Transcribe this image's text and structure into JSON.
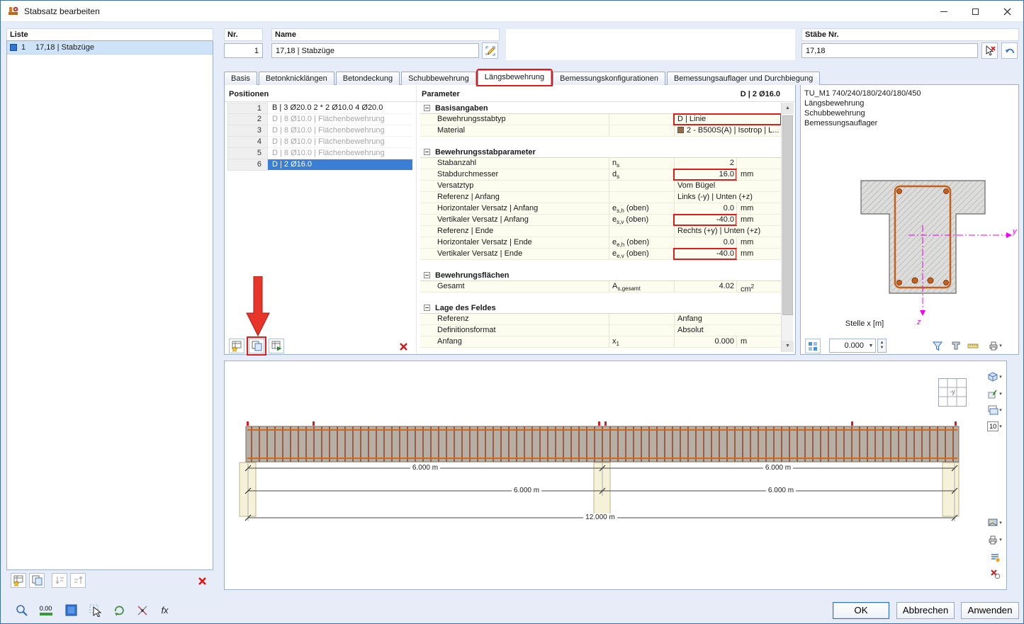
{
  "window": {
    "title": "Stabsatz bearbeiten"
  },
  "liste": {
    "label": "Liste",
    "items": [
      {
        "nr": "1",
        "label": "17,18 | Stabzüge"
      }
    ]
  },
  "header": {
    "nr": {
      "label": "Nr.",
      "value": "1"
    },
    "name": {
      "label": "Name",
      "value": "17,18 | Stabzüge"
    },
    "staebe": {
      "label": "Stäbe Nr.",
      "value": "17,18"
    }
  },
  "tabs": [
    "Basis",
    "Betonknicklängen",
    "Betondeckung",
    "Schubbewehrung",
    "Längsbewehrung",
    "Bemessungskonfigurationen",
    "Bemessungsauflager und Durchbiegung"
  ],
  "active_tab": "Längsbewehrung",
  "positionen": {
    "title": "Positionen",
    "rows": [
      {
        "nr": "1",
        "text": "B | 3 Ø20.0 2 * 2 Ø10.0 4 Ø20.0",
        "state": "normal"
      },
      {
        "nr": "2",
        "text": "D | 8 Ø10.0 | Flächenbewehrung",
        "state": "dim"
      },
      {
        "nr": "3",
        "text": "D | 8 Ø10.0 | Flächenbewehrung",
        "state": "dim"
      },
      {
        "nr": "4",
        "text": "D | 8 Ø10.0 | Flächenbewehrung",
        "state": "dim"
      },
      {
        "nr": "5",
        "text": "D | 8 Ø10.0 | Flächenbewehrung",
        "state": "dim"
      },
      {
        "nr": "6",
        "text": "D | 2 Ø16.0",
        "state": "selected"
      }
    ]
  },
  "parameter": {
    "title": "Parameter",
    "selection": "D | 2 Ø16.0",
    "sections": [
      {
        "title": "Basisangaben",
        "rows": [
          {
            "label": "Bewehrungsstabtyp",
            "symbol": "",
            "value": "D | Linie",
            "unit": "",
            "value_align": "left",
            "highlight": true
          },
          {
            "label": "Material",
            "symbol": "",
            "value": "2 - B500S(A) | Isotrop | L...",
            "unit": "",
            "value_align": "left",
            "swatch": "#9b6a49"
          }
        ]
      },
      {
        "title": "Bewehrungsstabparameter",
        "rows": [
          {
            "label": "Stabanzahl",
            "symbol": "n_{s}",
            "value": "2",
            "unit": ""
          },
          {
            "label": "Stabdurchmesser",
            "symbol": "d_{s}",
            "value": "16.0",
            "unit": "mm",
            "highlight": true
          },
          {
            "label": "Versatztyp",
            "symbol": "",
            "value": "Vom Bügel",
            "unit": "",
            "value_align": "left"
          },
          {
            "label": "Referenz | Anfang",
            "symbol": "",
            "value": "Links (-y) | Unten (+z)",
            "unit": "",
            "value_align": "left"
          },
          {
            "label": "Horizontaler Versatz | Anfang",
            "symbol": "e_{s,h} (oben)",
            "value": "0.0",
            "unit": "mm"
          },
          {
            "label": "Vertikaler Versatz | Anfang",
            "symbol": "e_{s,v} (oben)",
            "value": "-40.0",
            "unit": "mm",
            "highlight": true
          },
          {
            "label": "Referenz | Ende",
            "symbol": "",
            "value": "Rechts (+y) | Unten (+z)",
            "unit": "",
            "value_align": "left"
          },
          {
            "label": "Horizontaler Versatz | Ende",
            "symbol": "e_{e,h} (oben)",
            "value": "0.0",
            "unit": "mm"
          },
          {
            "label": "Vertikaler Versatz | Ende",
            "symbol": "e_{e,v} (oben)",
            "value": "-40.0",
            "unit": "mm",
            "highlight": true
          }
        ]
      },
      {
        "title": "Bewehrungsflächen",
        "rows": [
          {
            "label": "Gesamt",
            "symbol": "A_{s,gesamt}",
            "value": "4.02",
            "unit": "cm^{2}"
          }
        ]
      },
      {
        "title": "Lage des Feldes",
        "rows": [
          {
            "label": "Referenz",
            "symbol": "",
            "value": "Anfang",
            "unit": "",
            "value_align": "left"
          },
          {
            "label": "Definitionsformat",
            "symbol": "",
            "value": "Absolut",
            "unit": "",
            "value_align": "left"
          },
          {
            "label": "Anfang",
            "symbol": "x_{1}",
            "value": "0.000",
            "unit": "m"
          }
        ]
      }
    ]
  },
  "section_panel": {
    "info_lines": [
      "TU_M1 740/240/180/240/180/450",
      "Längsbewehrung",
      "Schubbewehrung",
      "Bemessungsauflager"
    ],
    "stelle_label": "Stelle x [m]",
    "stelle_value": "0.000",
    "axis_y": "y",
    "axis_z": "z"
  },
  "beam_view": {
    "dim_labels": [
      "6.000 m",
      "6.000 m",
      "6.000 m",
      "6.000 m",
      "12.000 m"
    ],
    "nav_label": "-y",
    "numbering_button_label": "10"
  },
  "statusbar": {
    "coord_display": "0.00"
  },
  "footer": {
    "ok": "OK",
    "cancel": "Abbrechen",
    "apply": "Anwenden"
  },
  "colors": {
    "selection_blue": "#3b7fd4",
    "annotation_red": "#e01b1b",
    "axis_magenta": "#ff00ff",
    "rebar_orange": "#c4601c",
    "material_swatch": "#9b6a49"
  }
}
